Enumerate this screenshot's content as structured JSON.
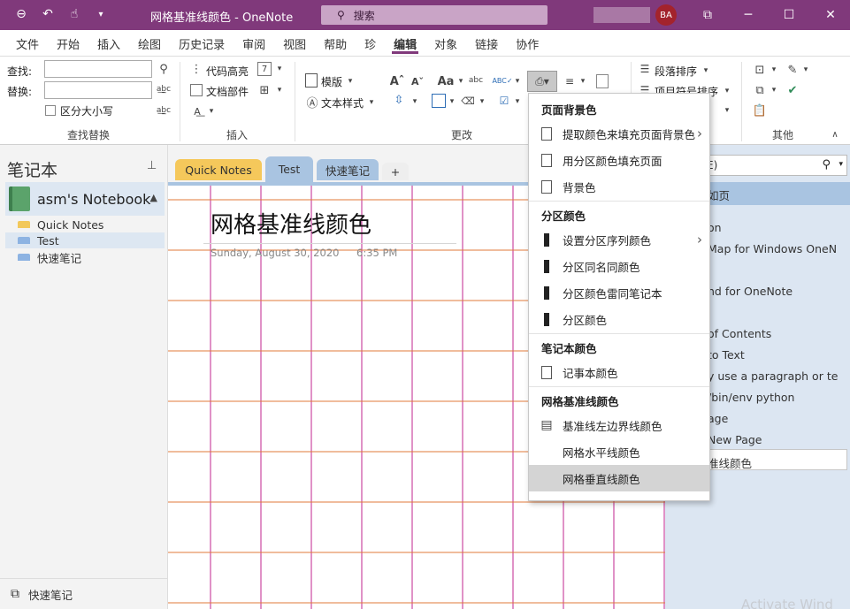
{
  "titlebar": {
    "title": "网格基准线颜色  -  OneNote",
    "search_label": "搜索",
    "avatar_initials": "BA"
  },
  "ribbon_tabs": [
    "文件",
    "开始",
    "插入",
    "绘图",
    "历史记录",
    "审阅",
    "视图",
    "帮助",
    "珍",
    "编辑",
    "对象",
    "链接",
    "协作"
  ],
  "active_tab": "编辑",
  "ribbon": {
    "find_label": "查找:",
    "replace_label": "替换:",
    "match_case_label": "区分大小写",
    "group_find_replace": "查找替换",
    "code_highlight": "代码高亮",
    "doc_parts": "文档部件",
    "group_insert": "插入",
    "template": "模版",
    "text_style": "文本样式",
    "group_change": "更改",
    "paragraph_sort": "段落排序",
    "list_sort_partial": "项目符号排序",
    "group_other": "其他"
  },
  "notebook_pane": {
    "title": "笔记本",
    "notebook_name": "asm's Notebook",
    "sections": [
      {
        "name": "Quick Notes",
        "color": "#f2c85b"
      },
      {
        "name": "Test",
        "color": "#8db3e2"
      },
      {
        "name": "快速笔记",
        "color": "#8db3e2"
      }
    ],
    "bottom_label": "快速笔记"
  },
  "section_tabs": [
    {
      "name": "Quick Notes",
      "color": "#f5c85b"
    },
    {
      "name": "Test",
      "color": "#a9c4e1"
    },
    {
      "name": "快速笔记",
      "color": "#a9c4e1"
    },
    {
      "name": "+",
      "color": "#eeeeee"
    }
  ],
  "page": {
    "title": "网格基准线颜色",
    "date": "Sunday, August 30, 2020",
    "time": "6:35 PM"
  },
  "page_list": {
    "search_tail": "E)",
    "header_tail": "如页",
    "items": [
      "on",
      "Map for Windows OneN",
      "nd for OneNote",
      "of Contents",
      "to Text",
      "y use a paragraph or te",
      "/bin/env python",
      "age",
      "New Page",
      "准线颜色"
    ]
  },
  "dropdown": {
    "sections": [
      {
        "header": "页面背景色",
        "items": [
          {
            "label": "提取颜色来填充页面背景色",
            "icon": "extract-color-icon",
            "submenu": true
          },
          {
            "label": "用分区颜色填充页面",
            "icon": "fill-page-icon",
            "submenu": false
          },
          {
            "label": "背景色",
            "icon": "background-color-icon",
            "submenu": false
          }
        ]
      },
      {
        "header": "分区颜色",
        "items": [
          {
            "label": "设置分区序列颜色",
            "icon": "section-color-icon",
            "submenu": true
          },
          {
            "label": "分区同名同颜色",
            "icon": "section-color-icon",
            "submenu": false
          },
          {
            "label": "分区颜色雷同笔记本",
            "icon": "section-color-icon",
            "submenu": false
          },
          {
            "label": "分区颜色",
            "icon": "section-color-icon",
            "submenu": false
          }
        ]
      },
      {
        "header": "笔记本颜色",
        "items": [
          {
            "label": "记事本颜色",
            "icon": "notebook-color-icon",
            "submenu": false
          }
        ]
      },
      {
        "header": "网格基准线颜色",
        "items": [
          {
            "label": "基准线左边界线颜色",
            "icon": "grid-margin-icon",
            "submenu": false
          },
          {
            "label": "网格水平线颜色",
            "icon": "",
            "submenu": false
          },
          {
            "label": "网格垂直线颜色",
            "icon": "",
            "submenu": false
          }
        ]
      }
    ]
  },
  "watermark": "Activate Wind",
  "colors": {
    "brand": "#80397b",
    "grid_horizontal": "#e07a3a",
    "grid_vertical": "#c0248f",
    "avatar": "#a3232c"
  }
}
